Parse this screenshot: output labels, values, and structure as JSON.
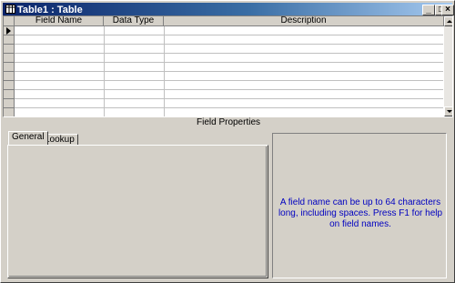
{
  "window": {
    "title": "Table1 : Table",
    "buttons": {
      "minimize": "_",
      "maximize": "□",
      "close": "×"
    }
  },
  "grid": {
    "columns": [
      "Field Name",
      "Data Type",
      "Description"
    ],
    "row_count": 10
  },
  "field_properties": {
    "label": "Field Properties",
    "tabs": [
      "General",
      "Lookup"
    ],
    "active_tab": "General",
    "help_text": "A field name can be up to 64 characters long, including spaces.  Press F1 for help on field names."
  },
  "colors": {
    "title_start": "#0a246a",
    "title_end": "#a6caf0",
    "help_text": "#0000c0",
    "face": "#d4d0c8"
  }
}
